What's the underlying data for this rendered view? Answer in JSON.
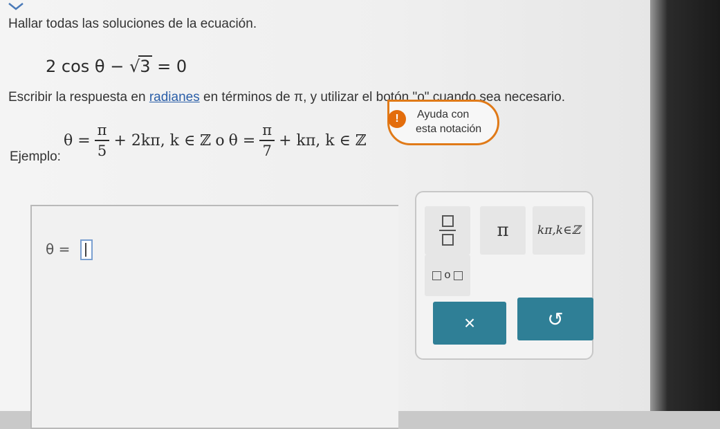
{
  "problem": {
    "instruction": "Hallar todas las soluciones de la ecuación.",
    "equation": {
      "left": "2 cos θ − ",
      "sqrt_arg": "3",
      "right": " = 0"
    },
    "directions": {
      "before_link": "Escribir la respuesta en ",
      "link": "radianes",
      "after_link": " en términos de π, y utilizar el botón \"o\" cuando sea necesario."
    }
  },
  "example": {
    "label": "Ejemplo:",
    "part1_prefix": "θ =",
    "part1_num": "π",
    "part1_den": "5",
    "part1_suffix": "+ 2kπ, k ∈ ℤ",
    "connector": "o",
    "part2_prefix": "θ =",
    "part2_num": "π",
    "part2_den": "7",
    "part2_suffix": "+ kπ, k ∈ ℤ"
  },
  "help": {
    "line1": "Ayuda con",
    "line2": "esta notación",
    "icon": "lightbulb-icon"
  },
  "answer": {
    "label": "θ =",
    "value": ""
  },
  "palette": {
    "pi": "π",
    "kpi": "kπ,k∈ℤ",
    "or_symbol": "o",
    "clear": "×",
    "undo": "↺"
  },
  "colors": {
    "accent_orange": "#e07a18",
    "button_teal": "#2f7f96",
    "link_blue": "#2a5ea8"
  }
}
